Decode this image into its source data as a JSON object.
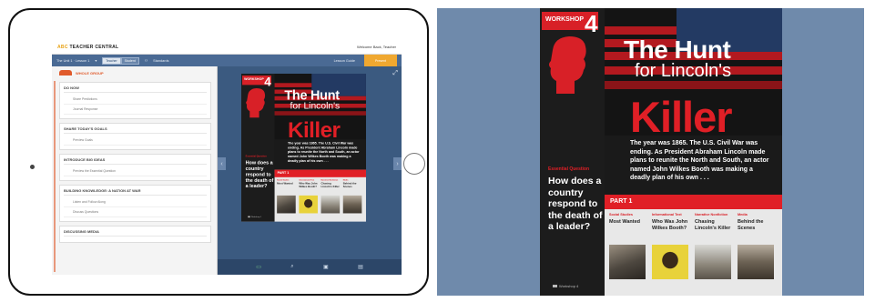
{
  "teacher_central": {
    "logo_prefix": "ABC",
    "logo_text": "TEACHER CENTRAL",
    "user_label": "Welcome Back, Teacher",
    "nav_breadcrumb": "The Unit 1 · Lesson 1",
    "toggle_options": [
      "Teacher",
      "Student"
    ],
    "nav_item": "Standards",
    "nav_right_item": "Lesson Guide",
    "action_button": "Present",
    "group_label": "WHOLE GROUP",
    "sections": [
      {
        "title": "DO NOW",
        "items": [
          "Share Predictions",
          "Journal Response"
        ]
      },
      {
        "title": "SHARE TODAY'S GOALS",
        "items": [
          "Preview Goals"
        ]
      },
      {
        "title": "INTRODUCE BIG IDEAS",
        "items": [
          "Preview the Essential Question"
        ]
      },
      {
        "title": "BUILDING KNOWLEDGE: A NATION AT WAR",
        "items": [
          "Listen and Follow Along",
          "Discuss Questions"
        ]
      },
      {
        "title": "DISCUSSING MEDIA",
        "items": []
      }
    ],
    "toolbar_icons": [
      "presentation-icon",
      "search-icon",
      "gallery-icon",
      "text-icon"
    ],
    "fullscreen_icon": "expand-icon"
  },
  "magazine": {
    "workshop_label": "WORKSHOP",
    "workshop_number": "4",
    "title_line1": "The Hunt",
    "title_line2": "for Lincoln's",
    "title_killer": "Killer",
    "body": "The year was 1865. The U.S. Civil War was ending. As President Abraham Lincoln made plans to reunite the North and South, an actor named John Wilkes Booth was making a deadly plan of his own . . .",
    "essential_question_label": "Essential Question",
    "essential_question": "How does a country respond to the death of a leader?",
    "part_label": "PART 1",
    "cards": [
      {
        "category": "Social Studies",
        "title": "Most Wanted"
      },
      {
        "category": "Informational Text",
        "title": "Who Was John Wilkes Booth?"
      },
      {
        "category": "Narrative Nonfiction",
        "title": "Chasing Lincoln's Killer"
      },
      {
        "category": "Media",
        "title": "Behind the Scenes"
      }
    ],
    "footer": "Workshop 4"
  },
  "colors": {
    "red": "#e01f26",
    "navy": "#3b5a80",
    "orange": "#f0a830",
    "zoom_background": "#6f8aab"
  }
}
